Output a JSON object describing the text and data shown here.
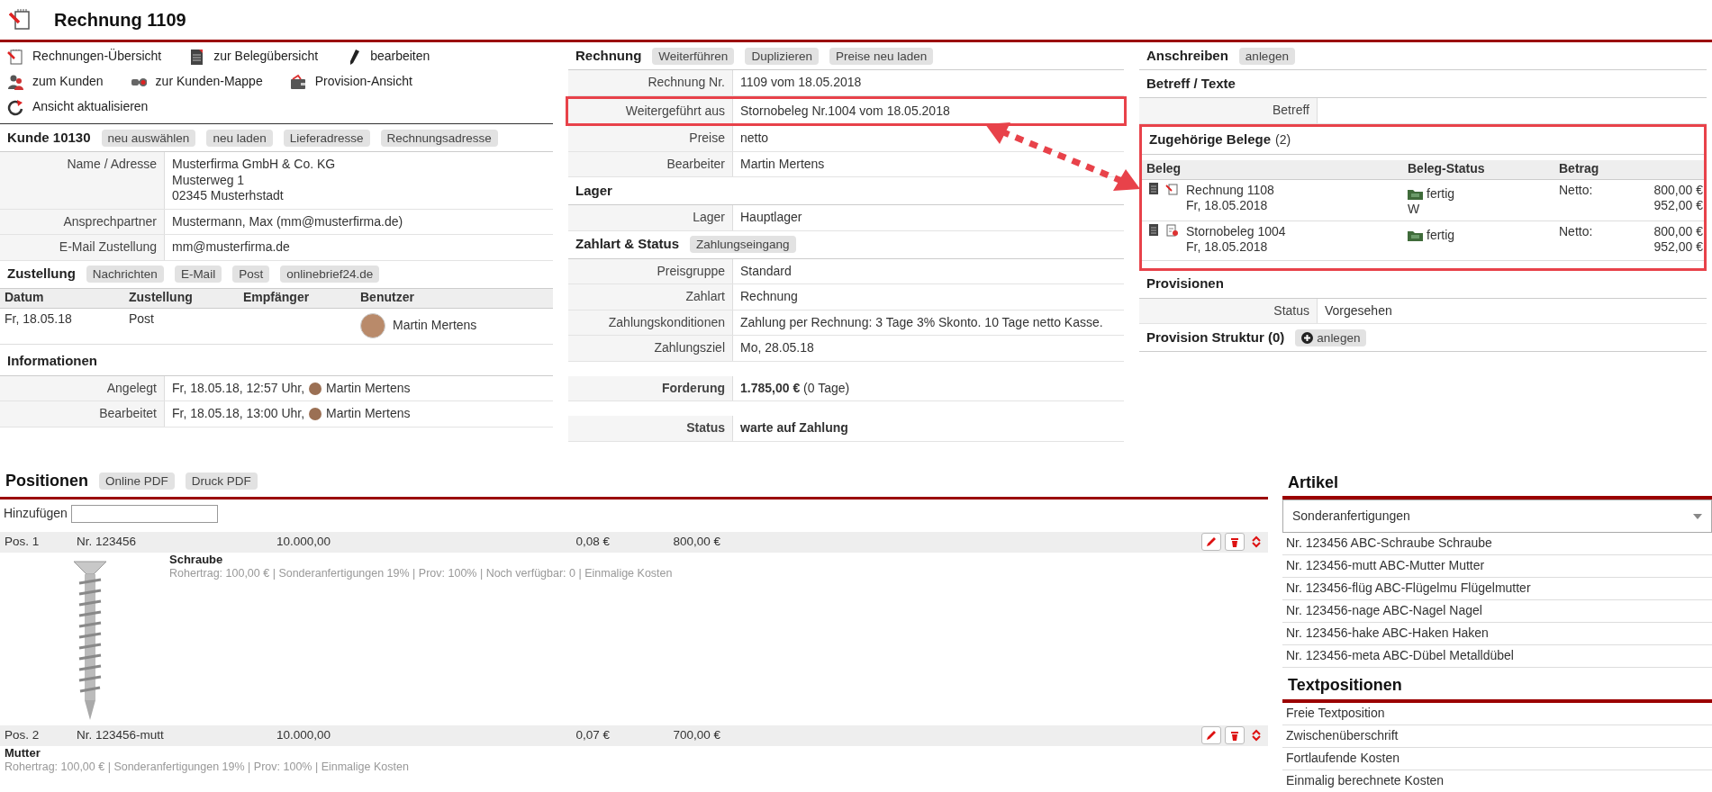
{
  "header": {
    "title": "Rechnung 1109"
  },
  "action_rows": [
    {
      "items": [
        {
          "kind": "invoice",
          "label": "Rechnungen-Übersicht"
        },
        {
          "kind": "document",
          "label": "zur Belegübersicht"
        },
        {
          "kind": "pencil",
          "label": "bearbeiten"
        }
      ]
    },
    {
      "items": [
        {
          "kind": "users",
          "label": "zum Kunden"
        },
        {
          "kind": "folder",
          "label": "zur Kunden-Mappe"
        },
        {
          "kind": "wallet",
          "label": "Provision-Ansicht"
        }
      ]
    },
    {
      "items": [
        {
          "kind": "refresh",
          "label": "Ansicht aktualisieren"
        }
      ]
    }
  ],
  "customer": {
    "title": "Kunde 10130",
    "buttons": [
      "neu auswählen",
      "neu laden",
      "Lieferadresse",
      "Rechnungsadresse"
    ],
    "fields": [
      {
        "label": "Name / Adresse",
        "lines": [
          "Musterfirma GmbH & Co. KG",
          "Musterweg 1",
          "02345 Musterhstadt"
        ]
      },
      {
        "label": "Ansprechpartner",
        "lines": [
          "Mustermann, Max (mm@musterfirma.de)"
        ]
      },
      {
        "label": "E-Mail Zustellung",
        "lines": [
          "mm@musterfirma.de"
        ]
      }
    ]
  },
  "delivery": {
    "title": "Zustellung",
    "buttons": [
      "Nachrichten",
      "E-Mail",
      "Post",
      "onlinebrief24.de"
    ],
    "columns": [
      "Datum",
      "Zustellung",
      "Empfänger",
      "Benutzer"
    ],
    "rows": [
      {
        "date": "Fr, 18.05.18",
        "channel": "Post",
        "user": "Martin Mertens"
      }
    ]
  },
  "info": {
    "title": "Informationen",
    "rows": [
      {
        "label": "Angelegt",
        "value": "Fr, 18.05.18, 12:57 Uhr,",
        "user": "Martin Mertens"
      },
      {
        "label": "Bearbeitet",
        "value": "Fr, 18.05.18, 13:00 Uhr,",
        "user": "Martin Mertens"
      }
    ]
  },
  "invoice": {
    "title": "Rechnung",
    "buttons": [
      "Weiterführen",
      "Duplizieren",
      "Preise neu laden"
    ],
    "fields": [
      {
        "label": "Rechnung Nr.",
        "value": "1109 vom 18.05.2018",
        "highlighted": false
      },
      {
        "label": "Weitergeführt aus",
        "value": "Stornobeleg Nr.1004 vom 18.05.2018",
        "highlighted": true
      },
      {
        "label": "Preise",
        "value": "netto",
        "highlighted": false
      },
      {
        "label": "Bearbeiter",
        "value": "Martin Mertens",
        "highlighted": false
      }
    ]
  },
  "storage": {
    "title": "Lager",
    "fields": [
      {
        "label": "Lager",
        "value": "Hauptlager"
      }
    ]
  },
  "payment": {
    "title": "Zahlart & Status",
    "buttons": [
      "Zahlungseingang"
    ],
    "fields": [
      {
        "label": "Preisgruppe",
        "value": "Standard",
        "spaced": false,
        "bold": false
      },
      {
        "label": "Zahlart",
        "value": "Rechnung",
        "spaced": false,
        "bold": false
      },
      {
        "label": "Zahlungskonditionen",
        "value": "Zahlung per Rechnung: 3 Tage 3% Skonto. 10 Tage netto Kasse.",
        "spaced": false,
        "bold": false
      },
      {
        "label": "Zahlungsziel",
        "value": "Mo, 28.05.18",
        "spaced": false,
        "bold": false
      },
      {
        "label": "Forderung",
        "value": "**1.785,00 €** (0 Tage)",
        "spaced": true,
        "bold": false
      },
      {
        "label": "Status",
        "value": "warte auf Zahlung",
        "spaced": true,
        "bold": true
      }
    ]
  },
  "letter": {
    "title": "Anschreiben",
    "buttons": [
      "anlegen"
    ]
  },
  "subject": {
    "title": "Betreff / Texte",
    "fields": [
      {
        "label": "Betreff"
      }
    ]
  },
  "related": {
    "title": "Zugehörige Belege",
    "count": "(2)",
    "highlighted": true,
    "columns": [
      "Beleg",
      "Beleg-Status",
      "Betrag"
    ],
    "rows": [
      {
        "kind": "invoice",
        "name": "Rechnung 1108",
        "date": "Fr, 18.05.2018",
        "status": "fertig",
        "note": "W",
        "amount_label": "Netto:",
        "amounts": [
          "800,00 €",
          "952,00 €"
        ]
      },
      {
        "kind": "cancellation",
        "name": "Stornobeleg 1004",
        "date": "Fr, 18.05.2018",
        "status": "fertig",
        "amount_label": "Netto:",
        "amounts": [
          "800,00 €",
          "952,00 €"
        ]
      }
    ]
  },
  "commissions": {
    "title": "Provisionen",
    "fields": [
      {
        "label": "Status",
        "value": "Vorgesehen"
      }
    ]
  },
  "commission_structure": {
    "title": "Provision Struktur (0)",
    "button": "anlegen"
  },
  "annotation_arrow": true,
  "positions": {
    "title": "Positionen",
    "buttons": [
      "Online PDF",
      "Druck PDF"
    ],
    "add_label": "Hinzufügen",
    "items": [
      {
        "pos": "Pos. 1",
        "number": "Nr. 123456",
        "quantity": "10.000,00",
        "price": "0,08 €",
        "total": "800,00 €",
        "name": "Schraube",
        "details": "Rohertrag: 100,00 € | Sonderanfertigungen 19% | Prov: 100% | Noch verfügbar: 0 | Einmalige Kosten",
        "has_image": true
      },
      {
        "pos": "Pos. 2",
        "number": "Nr. 123456-mutt",
        "quantity": "10.000,00",
        "price": "0,07 €",
        "total": "700,00 €",
        "name": "Mutter",
        "details": "Rohertrag: 100,00 € | Sonderanfertigungen 19% | Prov: 100% | Einmalige Kosten",
        "has_image": false
      }
    ]
  },
  "articles": {
    "title": "Artikel",
    "select": "Sonderanfertigungen",
    "items": [
      "Nr. 123456 ABC-Schraube Schraube",
      "Nr. 123456-mutt ABC-Mutter Mutter",
      "Nr. 123456-flüg ABC-Flügelmu Flügelmutter",
      "Nr. 123456-nage ABC-Nagel Nagel",
      "Nr. 123456-hake ABC-Haken Haken",
      "Nr. 123456-meta ABC-Dübel Metalldübel"
    ]
  },
  "text_positions": {
    "title": "Textpositionen",
    "items": [
      "Freie Textposition",
      "Zwischenüberschrift",
      "Fortlaufende Kosten",
      "Einmalig berechnete Kosten"
    ]
  }
}
